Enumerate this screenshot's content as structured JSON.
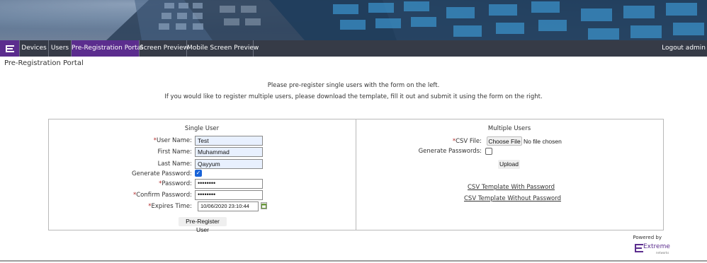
{
  "nav": {
    "items": [
      {
        "label": "Devices",
        "active": false
      },
      {
        "label": "Users",
        "active": false
      },
      {
        "label": "Pre-Registration Portal",
        "active": true
      },
      {
        "label": "Screen Preview",
        "active": false
      },
      {
        "label": "Mobile Screen Preview",
        "active": false
      }
    ],
    "logout_label": "Logout admin",
    "accent_color": "#5b2d8e",
    "bar_color": "#363b47"
  },
  "page_title": "Pre-Registration Portal",
  "intro": {
    "line1": "Please pre-register single users with the form on the left.",
    "line2": "If you would like to register multiple users, please download the template, fill it out and submit it using the form on the right."
  },
  "single_user": {
    "title": "Single User",
    "user_name_label": "User Name:",
    "user_name_value": "Test",
    "first_name_label": "First Name:",
    "first_name_value": "Muhammad",
    "last_name_label": "Last Name:",
    "last_name_value": "Qayyum",
    "generate_password_label": "Generate Password:",
    "generate_password_checked": true,
    "password_label": "Password:",
    "password_value": "••••••••",
    "confirm_password_label": "Confirm Password:",
    "confirm_password_value": "••••••••",
    "expires_time_label": "Expires Time:",
    "expires_time_value": "10/06/2020 23:10:44",
    "submit_label": "Pre-Register User"
  },
  "multiple_users": {
    "title": "Multiple Users",
    "csv_file_label": "CSV File:",
    "choose_file_label": "Choose File",
    "no_file_text": "No file chosen",
    "generate_passwords_label": "Generate Passwords:",
    "generate_passwords_checked": false,
    "upload_label": "Upload",
    "template_with_password": "CSV Template With Password",
    "template_without_password": "CSV Template Without Password"
  },
  "footer": {
    "powered_by": "Powered by",
    "brand": "Extreme",
    "brand_sub": "networks"
  },
  "required_marker": "*",
  "icons": [
    "extreme-logo-icon",
    "calendar-icon",
    "checkmark-icon"
  ]
}
